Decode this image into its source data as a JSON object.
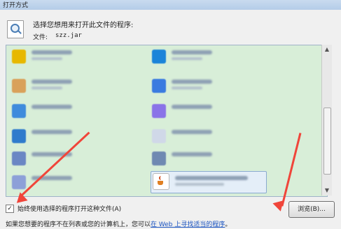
{
  "window": {
    "title": "打开方式"
  },
  "header": {
    "prompt": "选择您想用来打开此文件的程序:",
    "file_label": "文件:",
    "file_name": "szz.jar"
  },
  "footer": {
    "always_use_label": "始终使用选择的程序打开这种文件(A)",
    "always_use_checked": true,
    "browse_button": "浏览(B)...",
    "note_prefix": "如果您想要的程序不在列表或您的计算机上，您可以",
    "note_link": "在 Web 上寻找适当的程序",
    "note_suffix": "。"
  },
  "programs": {
    "items": [
      {
        "icon_color": "#e7b800",
        "selected": false
      },
      {
        "icon_color": "#d9a15a",
        "selected": false
      },
      {
        "icon_color": "#1b84d9",
        "selected": false
      },
      {
        "icon_color": "#3a7be0",
        "selected": false
      },
      {
        "icon_color": "#3f8bdc",
        "selected": false
      },
      {
        "icon_color": "#8da0d8",
        "selected": false
      },
      {
        "icon_color": "#2f7bcc",
        "selected": false
      },
      {
        "icon_color": "#6b87c4",
        "selected": false
      },
      {
        "icon_color": "#8a73e8",
        "selected": false
      },
      {
        "icon_color": "#d0d8e8",
        "selected": false
      },
      {
        "icon_color": "#6f89b2",
        "selected": false
      },
      {
        "icon_color": "#e07f22",
        "selected": true
      }
    ]
  }
}
